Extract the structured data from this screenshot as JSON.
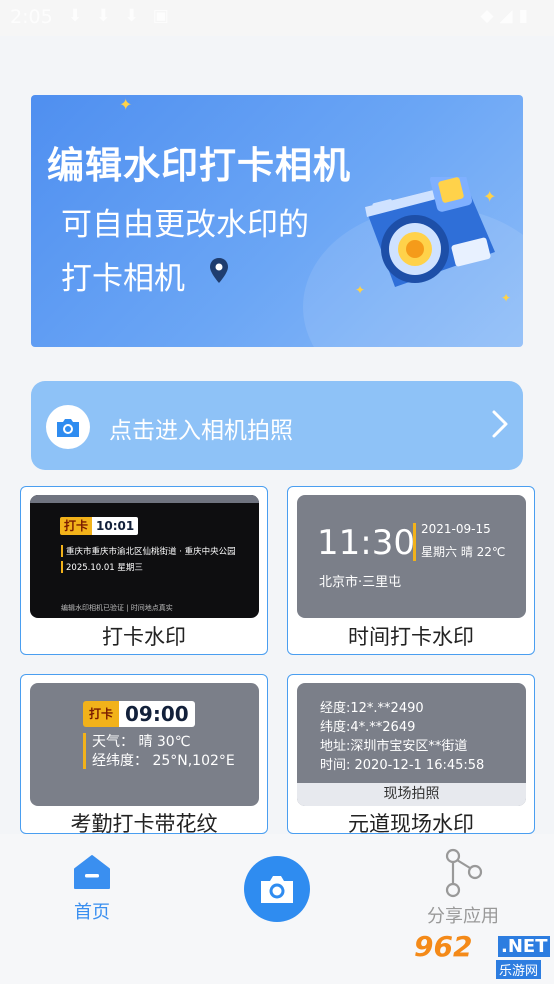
{
  "status_bar": {
    "time": "2:05"
  },
  "banner": {
    "title": "编辑水印打卡相机",
    "line2": "可自由更改水印的",
    "line3": "打卡相机"
  },
  "camera_entry": {
    "label": "点击进入相机拍照"
  },
  "cards": [
    {
      "caption": "打卡水印",
      "badge_logo": "打卡",
      "time": "10:01",
      "address": "重庆市重庆市渝北区仙桃街道 · 重庆中央公园",
      "date_line": "2025.10.01 星期三",
      "footer": "编辑水印相机已验证 | 时间地点真实"
    },
    {
      "caption": "时间打卡水印",
      "time": "11:30",
      "date": "2021-09-15",
      "weekday_weather": "星期六 晴 22℃",
      "location": "北京市·三里屯"
    },
    {
      "caption": "考勤打卡带花纹",
      "badge_logo": "打卡",
      "time": "09:00",
      "weather": "天气： 晴 30℃",
      "coords": "经纬度： 25°N,102°E"
    },
    {
      "caption": "元道现场水印",
      "latitude": "经度:12*.**2490",
      "longitude": "纬度:4*.**2649",
      "address": "地址:深圳市宝安区**街道",
      "time": "时间: 2020-12-1 16:45:58",
      "button": "现场拍照"
    }
  ],
  "bottom_nav": {
    "home_label": "首页",
    "share_label": "分享应用"
  },
  "watermark": {
    "brand": "962",
    "net": ".NET",
    "sub": "乐游网"
  },
  "colors": {
    "accent": "#2f8cf0",
    "entry_bg": "#8ec2f7",
    "badge_gold": "#f2b21a"
  }
}
